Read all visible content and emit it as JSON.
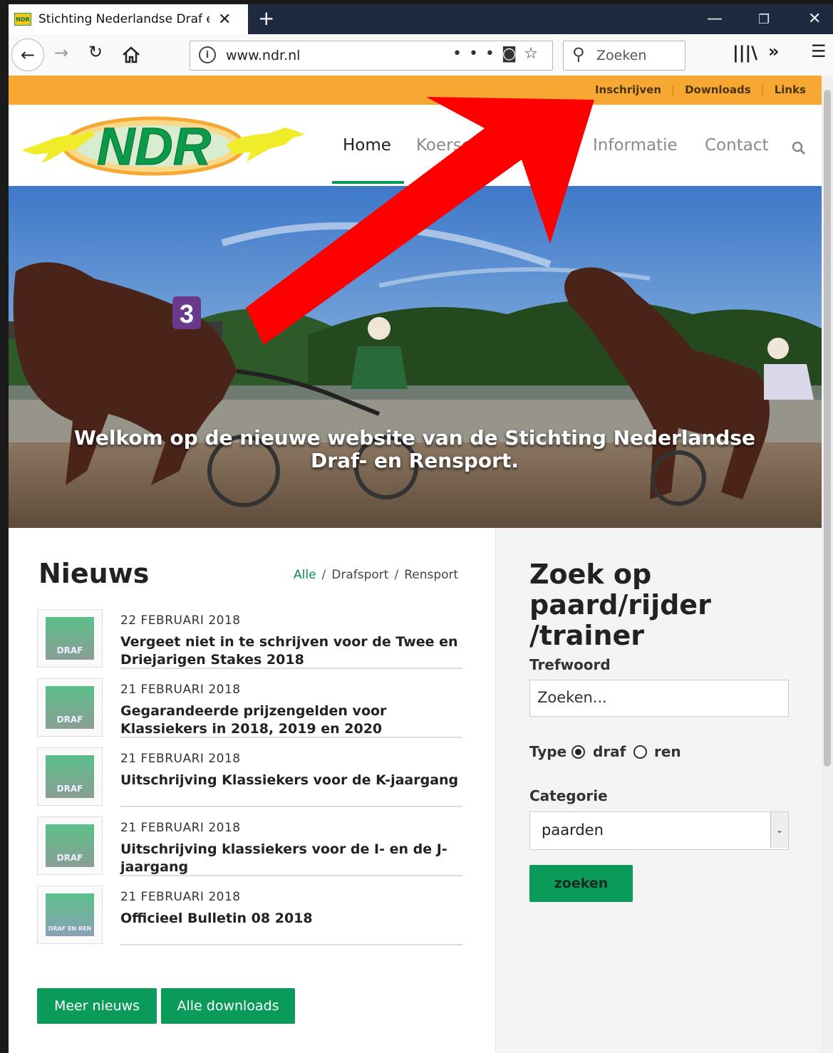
{
  "browser": {
    "tab_title": "Stichting Nederlandse Draf en R",
    "favicon_text": "NDR",
    "url": "www.ndr.nl",
    "search_placeholder": "Zoeken"
  },
  "site": {
    "logo_text": "NDR",
    "top_links": [
      "Inschrijven",
      "Downloads",
      "Links"
    ],
    "nav": {
      "home": "Home",
      "koersen": "Koersen",
      "informatie": "Informatie",
      "contact": "Contact"
    },
    "hero_caption": "Welkom op de nieuwe website van de Stichting Nederlandse Draf- en Rensport.",
    "hero_bib": "3",
    "accent_color": "#0a9a5a",
    "topbar_color": "#f7a832",
    "arrow_color": "#ff0000"
  },
  "news": {
    "title": "Nieuws",
    "filters": {
      "all": "Alle",
      "draf": "Drafsport",
      "ren": "Rensport"
    },
    "items": [
      {
        "date": "22 FEBRUARI 2018",
        "title": "Vergeet niet in te schrijven voor de Twee en Driejarigen Stakes 2018",
        "thumb": "DRAF"
      },
      {
        "date": "21 FEBRUARI 2018",
        "title": "Gegarandeerde prijzengelden voor Klassiekers in 2018, 2019 en 2020",
        "thumb": "DRAF"
      },
      {
        "date": "21 FEBRUARI 2018",
        "title": "Uitschrijving Klassiekers voor de K-jaargang",
        "thumb": "DRAF"
      },
      {
        "date": "21 FEBRUARI 2018",
        "title": "Uitschrijving klassiekers voor de I- en de J-jaargang",
        "thumb": "DRAF"
      },
      {
        "date": "21 FEBRUARI 2018",
        "title": "Officieel Bulletin 08 2018",
        "thumb": "DRAF EN REN"
      }
    ],
    "more_button": "Meer nieuws",
    "downloads_button": "Alle downloads"
  },
  "search_panel": {
    "title": "Zoek op paard/rijder /trainer",
    "keyword_label": "Trefwoord",
    "keyword_placeholder": "Zoeken...",
    "type_label": "Type",
    "type_draf": "draf",
    "type_ren": "ren",
    "type_selected": "draf",
    "category_label": "Categorie",
    "category_selected": "paarden",
    "submit": "zoeken"
  }
}
